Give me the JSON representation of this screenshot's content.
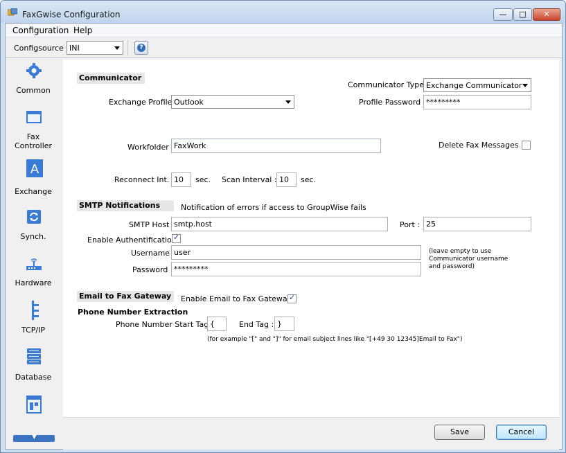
{
  "window": {
    "title": "FaxGwise Configuration"
  },
  "menu": [
    "Configuration",
    "Help"
  ],
  "toolbar": {
    "configsource_label": "Configsource :",
    "configsource_value": "INI"
  },
  "sidebar": {
    "items": [
      {
        "label": "Common",
        "icon": "gear-icon"
      },
      {
        "label": "Fax\nController",
        "icon": "window-icon"
      },
      {
        "label": "Exchange",
        "icon": "exchange-icon"
      },
      {
        "label": "Synch.",
        "icon": "sync-icon"
      },
      {
        "label": "Hardware",
        "icon": "modem-icon"
      },
      {
        "label": "TCP/IP",
        "icon": "network-icon"
      },
      {
        "label": "Database",
        "icon": "database-icon"
      }
    ]
  },
  "communicator": {
    "header": "Communicator",
    "type_label": "Communicator Type :",
    "type_value": "Exchange Communicator",
    "profile_label": "Exchange Profile :",
    "profile_value": "Outlook",
    "password_label": "Profile Password :",
    "password_value": "*********",
    "workfolder_label": "Workfolder :",
    "workfolder_value": "FaxWork",
    "delete_label": "Delete Fax Messages :",
    "delete_checked": false,
    "reconnect_label": "Reconnect Int. :",
    "reconnect_value": "10",
    "reconnect_unit": "sec.",
    "scan_label": "Scan Interval :",
    "scan_value": "10",
    "scan_unit": "sec."
  },
  "smtp": {
    "header": "SMTP Notifications",
    "description": "Notification of errors if access to GroupWise fails",
    "host_label": "SMTP Host :",
    "host_value": "smtp.host",
    "port_label": "Port :",
    "port_value": "25",
    "auth_label": "Enable Authentification :",
    "auth_checked": true,
    "username_label": "Username :",
    "username_value": "user",
    "password_label": "Password :",
    "password_value": "*********",
    "hint_1": "(leave empty to use",
    "hint_2": "Communicator username",
    "hint_3": "and password)"
  },
  "gateway": {
    "header": "Email to Fax Gateway",
    "enable_label": "Enable Email to Fax Gateway :",
    "enable_checked": true,
    "extraction_title": "Phone Number Extraction",
    "start_label": "Phone Number Start Tag :",
    "start_value": "{",
    "end_label": "End Tag :",
    "end_value": "}",
    "example": "(for example \"[\" and \"]\" for email subject lines like \"[+49 30 12345]Email to Fax\")"
  },
  "buttons": {
    "save": "Save",
    "cancel": "Cancel"
  },
  "colors": {
    "accent": "#2f6fb8",
    "titlebar": "#bfd4ec",
    "close": "#c9452e"
  }
}
